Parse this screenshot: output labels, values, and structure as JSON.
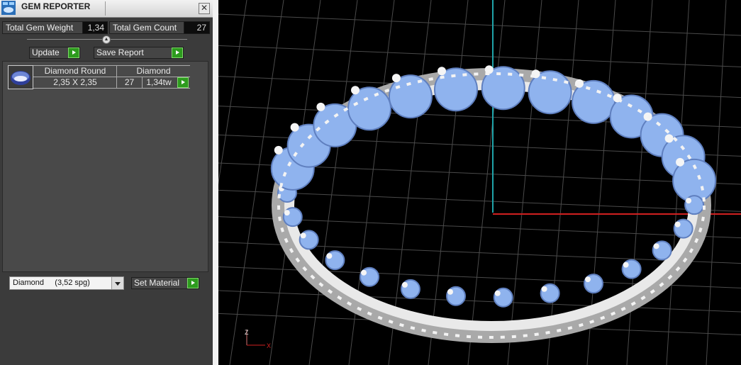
{
  "window": {
    "title": "GEM REPORTER",
    "close_glyph": "✕"
  },
  "stats": {
    "total_weight_label": "Total Gem Weight",
    "total_weight_value": "1,34",
    "total_count_label": "Total Gem Count",
    "total_count_value": "27"
  },
  "actions": {
    "update_label": "Update",
    "save_report_label": "Save Report"
  },
  "gem_table": {
    "headers": [
      "Diamond Round",
      "Diamond"
    ],
    "row": {
      "size": "2,35 X 2,35",
      "count": "27",
      "weight": "1,34tw"
    }
  },
  "material": {
    "selected": "Diamond     (3,52 spg)",
    "set_label": "Set Material"
  },
  "viewport": {
    "axis_labels": {
      "z": "Z",
      "x": "X"
    },
    "colors": {
      "gem": "#8fb3ee",
      "metal": "#e4e4e4",
      "grid": "#4a4a4a",
      "x_axis": "#d02020",
      "z_axis": "#1fa3a8"
    }
  },
  "icons": {
    "app": "gem-reporter-app-icon",
    "close": "close-icon",
    "play": "green-arrow-icon",
    "dropdown": "chevron-down-icon",
    "gem": "round-gem-icon"
  }
}
